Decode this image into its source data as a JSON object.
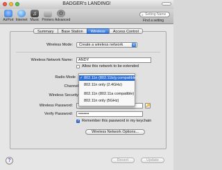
{
  "window": {
    "title": "BADGER's LANDING!"
  },
  "toolbar": {
    "items": [
      {
        "label": "AirPort",
        "icon": "airport-icon",
        "color": "#3a7de0"
      },
      {
        "label": "Internet",
        "icon": "internet-icon",
        "color": "#3a8ee8"
      },
      {
        "label": "Music",
        "icon": "music-icon",
        "color": "#555555"
      },
      {
        "label": "Printers",
        "icon": "printer-icon",
        "color": "#8e8e8e"
      },
      {
        "label": "Advanced",
        "icon": "gear-icon",
        "color": "#6d6d6d"
      }
    ],
    "search_placeholder": "Setting Name",
    "find_label": "Find a setting"
  },
  "tabs": [
    {
      "label": "Summary",
      "selected": false
    },
    {
      "label": "Base Station",
      "selected": false
    },
    {
      "label": "Wireless",
      "selected": true
    },
    {
      "label": "Access Control",
      "selected": false
    }
  ],
  "form": {
    "wireless_mode_label": "Wireless Mode:",
    "wireless_mode_value": "Create a wireless network",
    "network_name_label": "Wireless Network Name:",
    "network_name_value": "ANDY",
    "allow_extend_label": "Allow this network to be extended",
    "allow_extend_checked": false,
    "radio_mode_label": "Radio Mode",
    "channel_label": "Channel",
    "security_label": "Wireless Security",
    "password_label": "Wireless Password:",
    "password_value": "••••••••",
    "verify_label": "Verify Password:",
    "verify_value": "••••••••",
    "remember_label": "Remember this password in my keychain",
    "remember_checked": true,
    "options_button": "Wireless Network Options..."
  },
  "radio_menu": {
    "items": [
      {
        "label": "802.11n (802.11b/g compatible)",
        "selected": true
      },
      {
        "label": "802.11n only (2.4GHz)",
        "selected": false
      },
      {
        "label": "802.11n (802.11a compatible)",
        "selected": false
      },
      {
        "label": "802.11n only (5GHz)",
        "selected": false
      }
    ]
  },
  "footer": {
    "revert_label": "Revert",
    "update_label": "Update",
    "help_label": "?"
  }
}
